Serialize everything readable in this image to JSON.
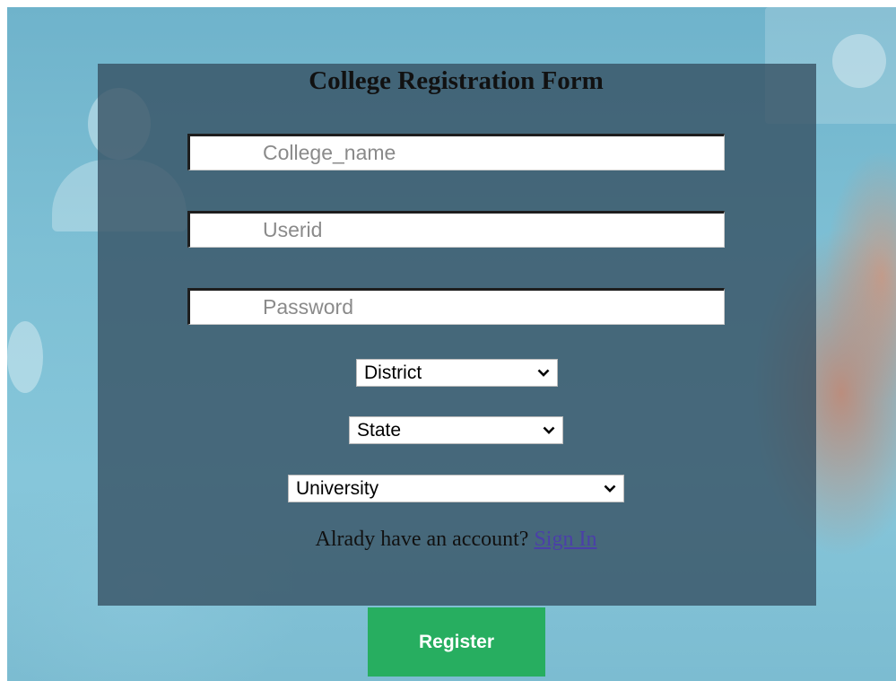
{
  "form": {
    "title": "College Registration Form",
    "college_name_placeholder": "College_name",
    "userid_placeholder": "Userid",
    "password_placeholder": "Password",
    "district_selected": "District",
    "state_selected": "State",
    "university_selected": "University",
    "account_prompt": "Alrady have an account? ",
    "signin_link": "Sign In",
    "register_label": "Register"
  },
  "colors": {
    "panel": "#344e60",
    "register_button": "#27ae60",
    "link": "#4b3fa9"
  },
  "icons": {
    "dropdown": "chevron-down-icon"
  }
}
